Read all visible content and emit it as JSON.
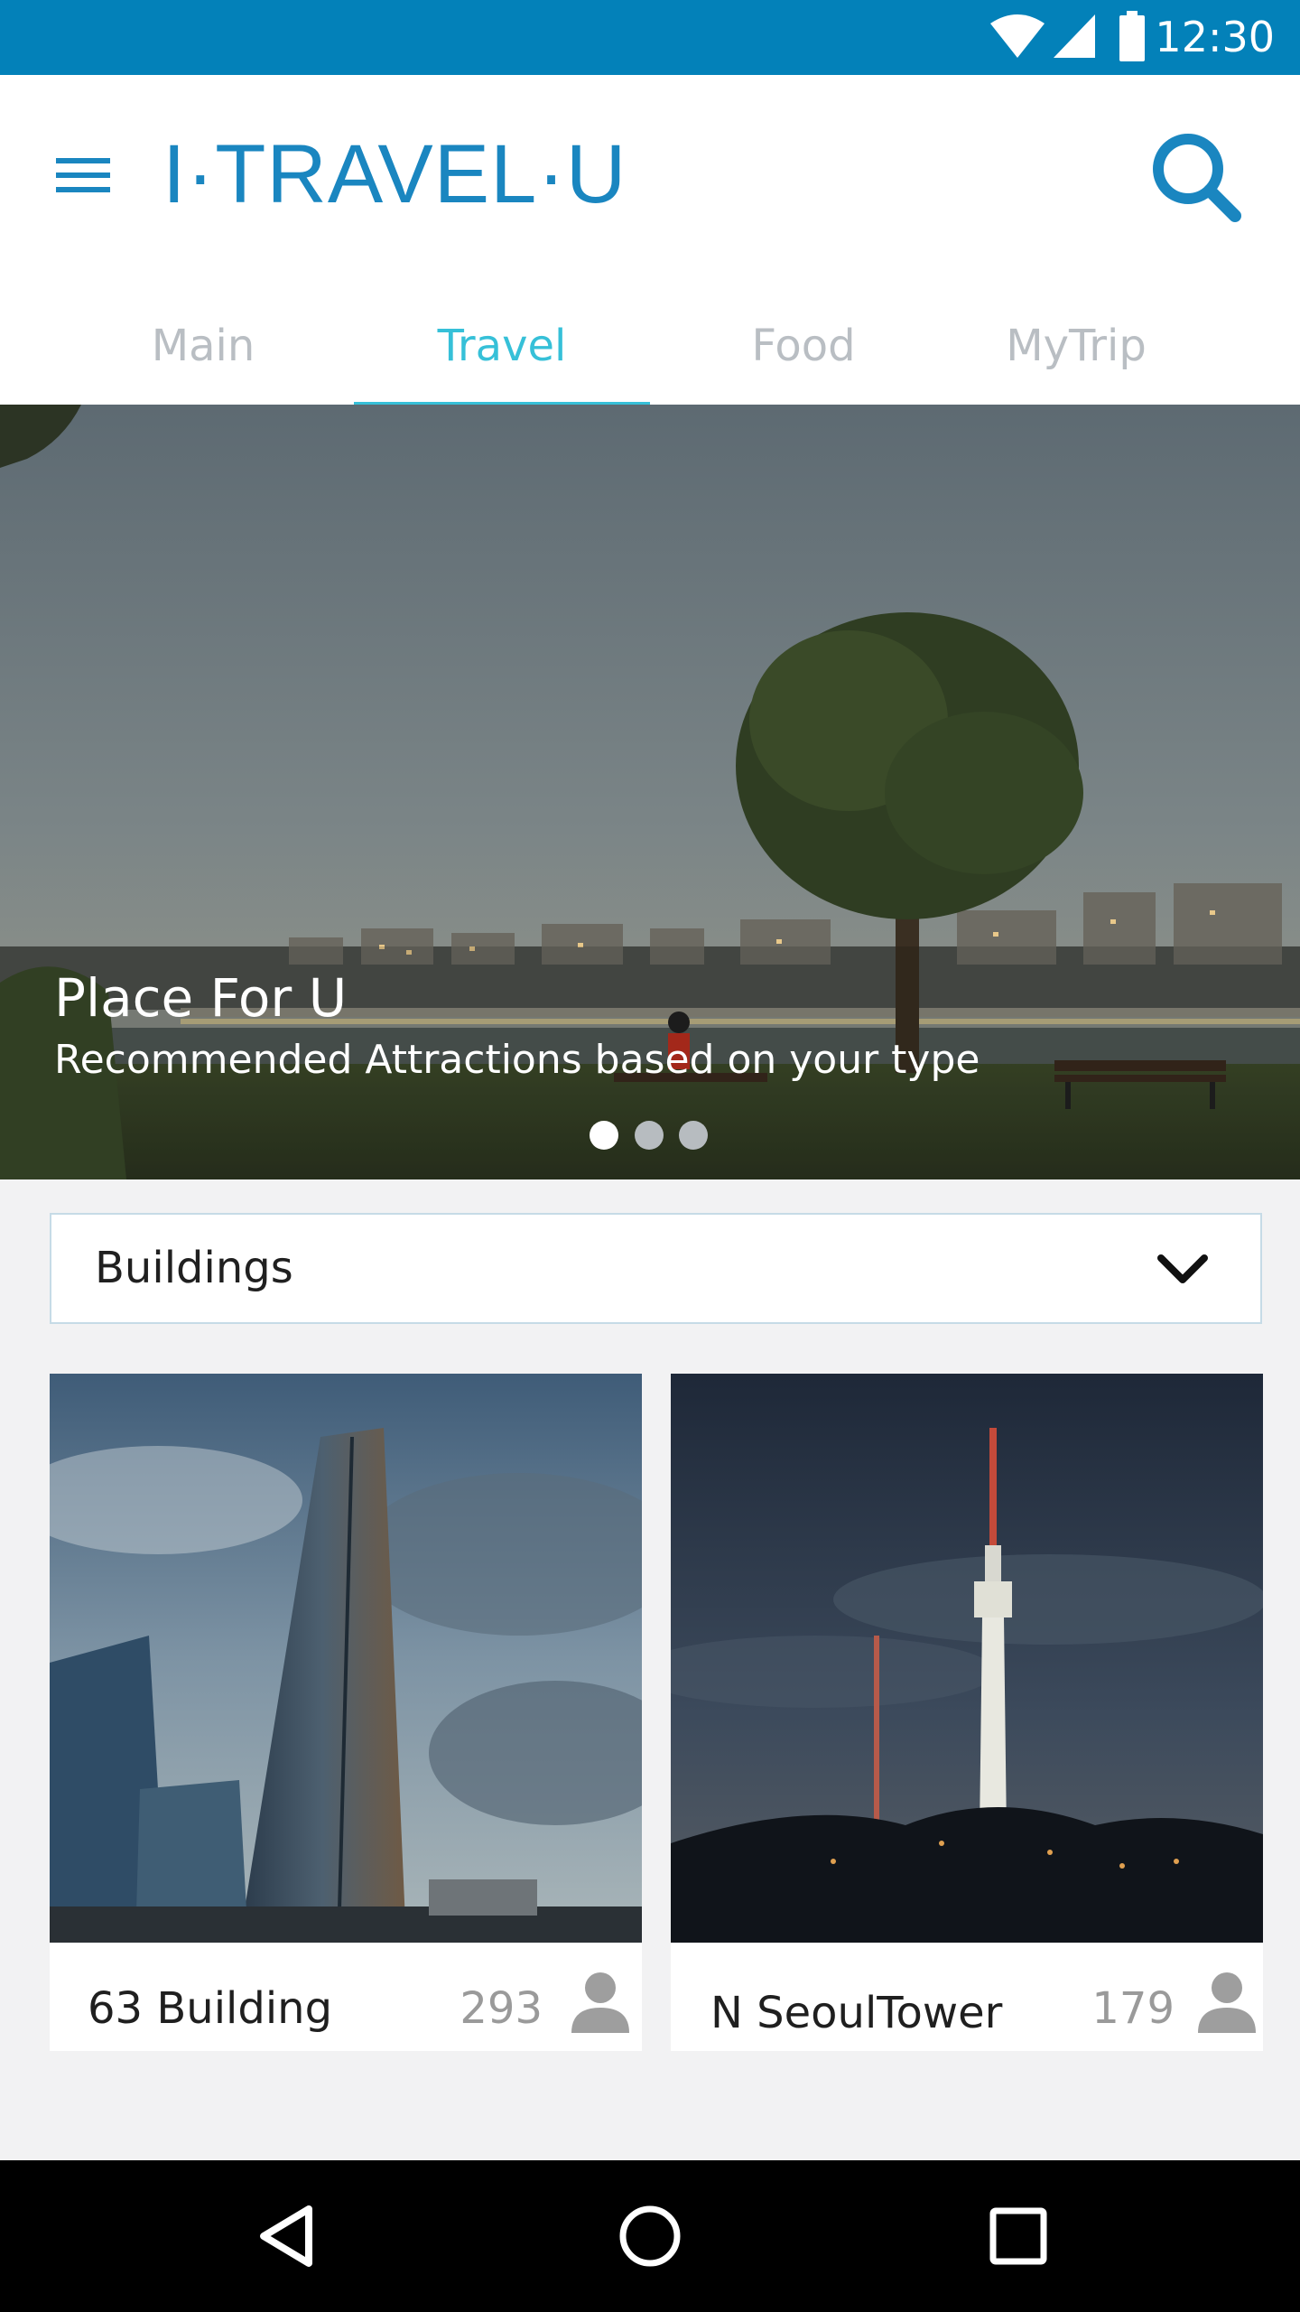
{
  "status_bar": {
    "time": "12:30",
    "icons": [
      "wifi-icon",
      "cell-signal-icon",
      "battery-icon"
    ],
    "background": "#0381b9"
  },
  "header": {
    "brand": "I·TRAVEL·U",
    "menu_icon": "hamburger-menu-icon",
    "search_icon": "search-icon",
    "accent": "#1a86c0"
  },
  "tabs": [
    {
      "label": "Main",
      "active": false
    },
    {
      "label": "Travel",
      "active": true
    },
    {
      "label": "Food",
      "active": false
    },
    {
      "label": "MyTrip",
      "active": false
    }
  ],
  "hero": {
    "title": "Place For U",
    "subtitle": "Recommended Attractions based on your type",
    "page_indicator": {
      "pages": 3,
      "current": 1
    }
  },
  "category_select": {
    "selected": "Buildings",
    "icon": "chevron-down-icon"
  },
  "cards": [
    {
      "name": "63 Building",
      "count": "293",
      "icon": "person-icon"
    },
    {
      "name": "N SeoulTower",
      "count": "179",
      "icon": "person-icon"
    }
  ],
  "nav_bar": {
    "icons": [
      "back-icon",
      "home-icon",
      "recents-icon"
    ]
  },
  "colors": {
    "tab_active": "#36c0d8",
    "tab_inactive": "#b9bec3",
    "page_bg": "#f2f2f3"
  }
}
